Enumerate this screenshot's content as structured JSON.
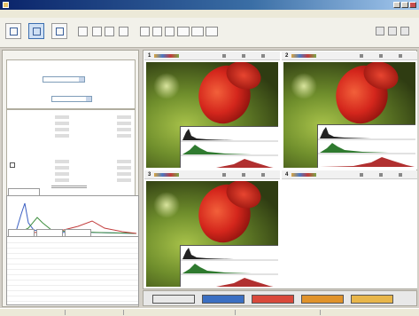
{
  "window": {
    "title": ""
  },
  "menu": {
    "items": [
      "",
      "",
      "",
      ""
    ]
  },
  "viewer": {
    "panes": [
      {
        "number": "1",
        "label": ""
      },
      {
        "number": "2",
        "label": ""
      },
      {
        "number": "3",
        "label": ""
      },
      {
        "number": "4",
        "label": ""
      }
    ]
  },
  "tabs": {
    "items": [
      {
        "label": "",
        "color": "#e8e8e8"
      },
      {
        "label": "",
        "color": "#3b6fc2"
      },
      {
        "label": "",
        "color": "#d9493b"
      },
      {
        "label": "",
        "color": "#e0932b"
      },
      {
        "label": "",
        "color": "#e8b64a"
      }
    ]
  },
  "colors": {
    "title_gradient_start": "#0a246a",
    "accent": "#3c6fb0",
    "histogram_red": "#c23b3b",
    "histogram_green": "#3f8f3f",
    "histogram_blue": "#3b5fc2"
  }
}
